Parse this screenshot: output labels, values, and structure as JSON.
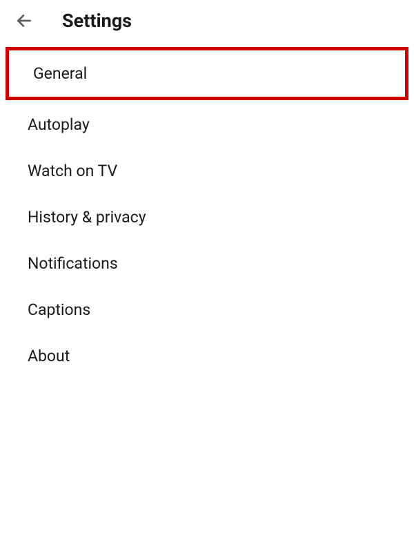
{
  "header": {
    "title": "Settings"
  },
  "items": [
    {
      "label": "General",
      "highlighted": true
    },
    {
      "label": "Autoplay",
      "highlighted": false
    },
    {
      "label": "Watch on TV",
      "highlighted": false
    },
    {
      "label": "History & privacy",
      "highlighted": false
    },
    {
      "label": "Notifications",
      "highlighted": false
    },
    {
      "label": "Captions",
      "highlighted": false
    },
    {
      "label": "About",
      "highlighted": false
    }
  ]
}
